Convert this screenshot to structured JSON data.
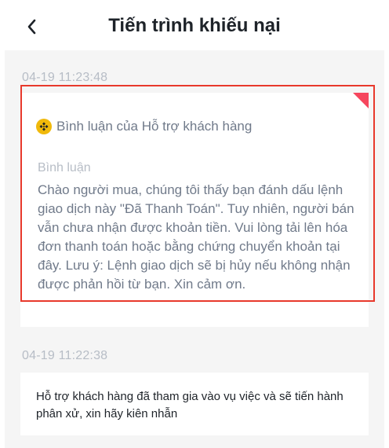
{
  "header": {
    "title": "Tiến trình khiếu nại",
    "back_icon": "chevron-left-icon"
  },
  "timeline": [
    {
      "timestamp": "04-19 11:23:48",
      "author_icon": "binance-logo-icon",
      "author": "Bình luận của Hỗ trợ khách hàng",
      "comment_label": "Bình luận",
      "comment": "Chào người mua, chúng tôi thấy bạn đánh dấu lệnh giao dịch này \"Đã Thanh Toán\". Tuy nhiên, người bán vẫn chưa nhận được khoản tiền. Vui lòng tải lên hóa đơn thanh toán hoặc bằng chứng chuyển khoản tại đây. Lưu ý: Lệnh giao dịch sẽ bị hủy nếu không nhận được phản hồi từ bạn. Xin cảm ơn."
    },
    {
      "timestamp": "04-19 11:22:38",
      "message": "Hỗ trợ khách hàng đã tham gia vào vụ việc và sẽ tiến hành phân xử, xin hãy kiên nhẫn"
    }
  ],
  "colors": {
    "accent_red": "#f6465d",
    "highlight_border": "#e8392c",
    "brand_yellow": "#f0b90b"
  }
}
